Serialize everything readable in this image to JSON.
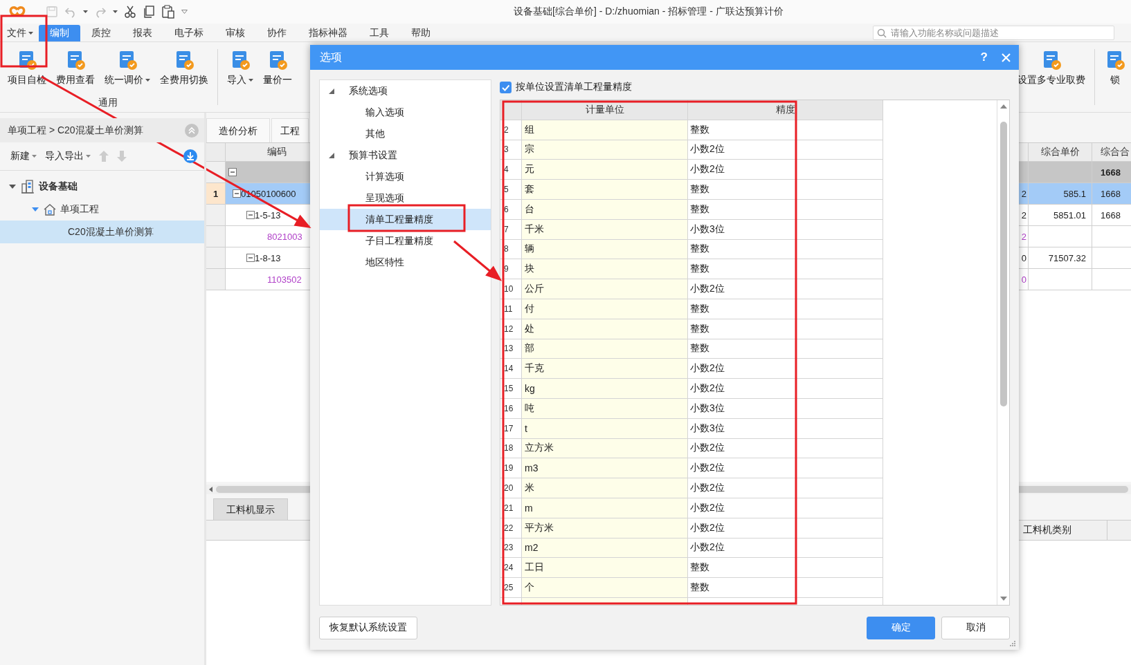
{
  "title_bar": {
    "title": "设备基础[综合单价] - D:/zhuomian - 招标管理 - 广联达预算计价"
  },
  "menu": {
    "items": [
      {
        "label": "文件",
        "dropdown": true,
        "selected": false
      },
      {
        "label": "编制",
        "dropdown": false,
        "selected": true
      },
      {
        "label": "质控",
        "dropdown": false,
        "selected": false
      },
      {
        "label": "报表",
        "dropdown": false,
        "selected": false
      },
      {
        "label": "电子标",
        "dropdown": false,
        "selected": false
      },
      {
        "label": "审核",
        "dropdown": false,
        "selected": false
      },
      {
        "label": "协作",
        "dropdown": false,
        "selected": false
      },
      {
        "label": "指标神器",
        "dropdown": false,
        "selected": false
      },
      {
        "label": "工具",
        "dropdown": false,
        "selected": false
      },
      {
        "label": "帮助",
        "dropdown": false,
        "selected": false
      }
    ],
    "search": {
      "placeholder": "请输入功能名称或问题描述"
    }
  },
  "ribbon": {
    "groups": [
      {
        "label": "通用",
        "buttons": [
          {
            "label": "项目自检",
            "dropdown": false
          },
          {
            "label": "费用查看",
            "dropdown": false
          },
          {
            "label": "统一调价",
            "dropdown": true
          },
          {
            "label": "全费用切换",
            "dropdown": false
          }
        ]
      },
      {
        "buttons": [
          {
            "label": "导入",
            "dropdown": true
          },
          {
            "label": "量价一",
            "dropdown": false
          }
        ]
      }
    ],
    "right_buttons": [
      {
        "label": "设置多专业取费",
        "dropdown": false
      },
      {
        "label": "锁",
        "dropdown": false
      }
    ]
  },
  "left_panel": {
    "breadcrumb": "单项工程 > C20混凝土单价测算",
    "toolbar": [
      {
        "label": "新建",
        "dropdown": true
      },
      {
        "label": "导入导出",
        "dropdown": true
      }
    ],
    "tree": [
      {
        "label": "设备基础",
        "selected": false,
        "expanded": true,
        "children": [
          {
            "label": "单项工程",
            "selected": false,
            "expanded": true,
            "children": [
              {
                "label": "C20混凝土单价测算",
                "selected": true
              }
            ]
          }
        ]
      }
    ]
  },
  "tabs": [
    {
      "label": "造价分析"
    },
    {
      "label": "工程"
    }
  ],
  "table": {
    "columns": [
      "编码",
      "综合单价",
      "综合合"
    ],
    "rows": [
      {
        "kind": "group",
        "total": "1668",
        "selected": false
      },
      {
        "kind": "item",
        "number": "1",
        "code": "01050100600",
        "tail": "2",
        "unit_price": "585.1",
        "total": "1668",
        "selected": true
      },
      {
        "kind": "sub",
        "code": "1-5-13",
        "tail": "2",
        "unit_price": "5851.01",
        "total": "1668",
        "selected": false
      },
      {
        "kind": "resource",
        "code": "8021003",
        "tail": "2",
        "selected": false
      },
      {
        "kind": "sub",
        "code": "1-8-13",
        "tail": "0",
        "unit_price": "71507.32",
        "selected": false
      },
      {
        "kind": "resource",
        "code": "1103502",
        "tail": "0",
        "selected": false
      }
    ]
  },
  "bottom_tabs": [
    {
      "label": "工料机显示"
    }
  ],
  "bottom_table": {
    "columns": [
      "工料机类别"
    ]
  },
  "dialog": {
    "title": "选项",
    "help": "?",
    "tree": [
      {
        "label": "系统选项",
        "expanded": true,
        "selected": false,
        "children": [
          {
            "label": "输入选项",
            "selected": false
          },
          {
            "label": "其他",
            "selected": false
          }
        ]
      },
      {
        "label": "预算书设置",
        "expanded": true,
        "selected": false,
        "children": [
          {
            "label": "计算选项",
            "selected": false
          },
          {
            "label": "呈现选项",
            "selected": false
          },
          {
            "label": "清单工程量精度",
            "selected": true
          },
          {
            "label": "子目工程量精度",
            "selected": false
          },
          {
            "label": "地区特性",
            "selected": false
          }
        ]
      }
    ],
    "checkbox": {
      "label": "按单位设置清单工程量精度",
      "checked": true
    },
    "grid": {
      "columns": [
        "计量单位",
        "精度"
      ],
      "rows": [
        {
          "number": "2",
          "unit": "组",
          "precision": "整数"
        },
        {
          "number": "3",
          "unit": "宗",
          "precision": "小数2位"
        },
        {
          "number": "4",
          "unit": "元",
          "precision": "小数2位"
        },
        {
          "number": "5",
          "unit": "套",
          "precision": "整数"
        },
        {
          "number": "6",
          "unit": "台",
          "precision": "整数"
        },
        {
          "number": "7",
          "unit": "千米",
          "precision": "小数3位"
        },
        {
          "number": "8",
          "unit": "辆",
          "precision": "整数"
        },
        {
          "number": "9",
          "unit": "块",
          "precision": "整数"
        },
        {
          "number": "10",
          "unit": "公斤",
          "precision": "小数2位"
        },
        {
          "number": "11",
          "unit": "付",
          "precision": "整数"
        },
        {
          "number": "12",
          "unit": "处",
          "precision": "整数"
        },
        {
          "number": "13",
          "unit": "部",
          "precision": "整数"
        },
        {
          "number": "14",
          "unit": "千克",
          "precision": "小数2位"
        },
        {
          "number": "15",
          "unit": "kg",
          "precision": "小数2位"
        },
        {
          "number": "16",
          "unit": "吨",
          "precision": "小数3位"
        },
        {
          "number": "17",
          "unit": "t",
          "precision": "小数3位"
        },
        {
          "number": "18",
          "unit": "立方米",
          "precision": "小数2位"
        },
        {
          "number": "19",
          "unit": "m3",
          "precision": "小数2位"
        },
        {
          "number": "20",
          "unit": "米",
          "precision": "小数2位"
        },
        {
          "number": "21",
          "unit": "m",
          "precision": "小数2位"
        },
        {
          "number": "22",
          "unit": "平方米",
          "precision": "小数2位"
        },
        {
          "number": "23",
          "unit": "m2",
          "precision": "小数2位"
        },
        {
          "number": "24",
          "unit": "工日",
          "precision": "整数"
        },
        {
          "number": "25",
          "unit": "个",
          "precision": "整数"
        }
      ]
    },
    "buttons": [
      {
        "kind": "restore",
        "label": "恢复默认系统设置"
      },
      {
        "kind": "ok",
        "label": "确定"
      },
      {
        "kind": "cancel",
        "label": "取消"
      }
    ]
  },
  "annotations": [
    {
      "kind": "frame"
    },
    {
      "kind": "arrow"
    },
    {
      "kind": "frame"
    },
    {
      "kind": "arrow"
    },
    {
      "kind": "frame"
    }
  ]
}
